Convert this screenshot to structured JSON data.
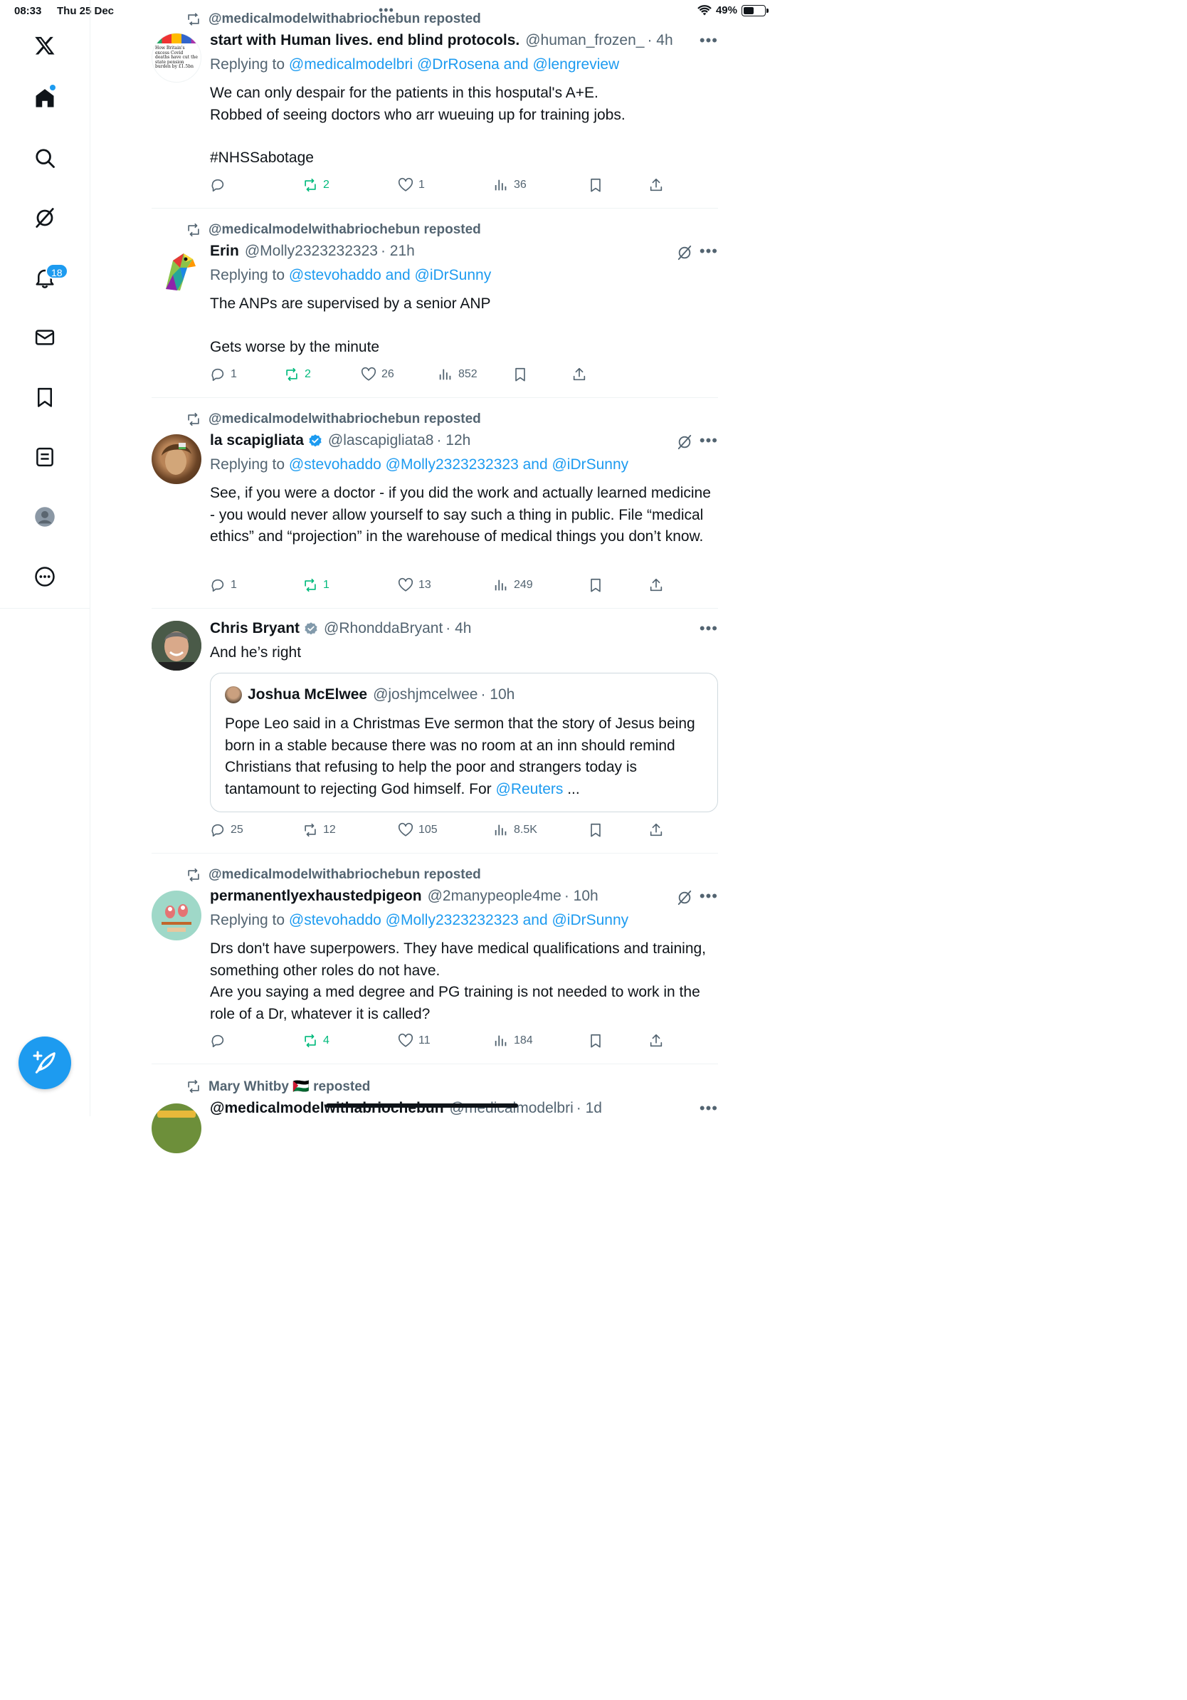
{
  "status_bar": {
    "time": "08:33",
    "date": "Thu 25 Dec",
    "battery": "49%"
  },
  "sidebar": {
    "notifications_badge": "18",
    "items": [
      "logo",
      "home",
      "search",
      "grok",
      "notifications",
      "messages",
      "bookmarks",
      "lists",
      "profile",
      "more"
    ]
  },
  "posts": [
    {
      "reposted_by": "@medicalmodelwithabriochebun reposted",
      "name": "start with Human lives. end blind protocols.",
      "handle": "@human_frozen_",
      "time": "· 4h",
      "replying_prefix": "Replying to",
      "replying_to": "@medicalmodelbri @DrRosena and @lengreview",
      "text": "We can only despair for the patients in this hosputal's A+E.\nRobbed of seeing doctors who arr wueuing up for training jobs.",
      "hashtag": "#NHSSabotage",
      "avatar_text": "How Britain's excess Covid deaths have cut the state pension burden by £1.5bn",
      "stats": {
        "replies": "",
        "reposts": "2",
        "likes": "1",
        "views": "36"
      }
    },
    {
      "reposted_by": "@medicalmodelwithabriochebun reposted",
      "name": "Erin",
      "handle": "@Molly2323232323",
      "time": "· 21h",
      "replying_prefix": "Replying to",
      "replying_to": "@stevohaddo and @iDrSunny",
      "text": "The ANPs are supervised by a senior ANP\n\nGets worse by the minute",
      "stats": {
        "replies": "1",
        "reposts": "2",
        "likes": "26",
        "views": "852"
      }
    },
    {
      "reposted_by": "@medicalmodelwithabriochebun reposted",
      "name": "la scapigliata",
      "handle": "@lascapigliata8",
      "time": "· 12h",
      "replying_prefix": "Replying to",
      "replying_to": "@stevohaddo @Molly2323232323 and @iDrSunny",
      "text": "See, if you were a doctor - if you did the work and actually learned medicine - you would never allow yourself to say such a thing in public. File “medical ethics” and “projection” in the warehouse of medical things you don’t know.",
      "stats": {
        "replies": "1",
        "reposts": "1",
        "likes": "13",
        "views": "249"
      }
    },
    {
      "name": "Chris Bryant",
      "handle": "@RhonddaBryant",
      "time": "· 4h",
      "text": "And he’s right",
      "quote": {
        "name": "Joshua McElwee",
        "handle": "@joshjmcelwee",
        "time": "· 10h",
        "text": "Pope Leo said in a Christmas Eve sermon that the story of Jesus being born in a stable because there was no room at an inn should remind Christians that refusing to help the poor and strangers today is tantamount to rejecting God himself. For ",
        "link": "@Reuters",
        "ellipsis": " ..."
      },
      "stats": {
        "replies": "25",
        "reposts": "12",
        "likes": "105",
        "views": "8.5K"
      }
    },
    {
      "reposted_by": "@medicalmodelwithabriochebun reposted",
      "name": "permanentlyexhaustedpigeon",
      "handle": "@2manypeople4me",
      "time": "· 10h",
      "replying_prefix": "Replying to",
      "replying_to": "@stevohaddo @Molly2323232323 and @iDrSunny",
      "text": "Drs don't have superpowers. They have medical qualifications and training, something other roles do not have.\nAre you saying a med degree and PG training is not needed to work in the role of a Dr, whatever it is called?",
      "stats": {
        "replies": "",
        "reposts": "4",
        "likes": "11",
        "views": "184"
      }
    },
    {
      "reposted_by": "Mary Whitby 🇵🇸 reposted",
      "name": "@medicalmodelwithabriochebun",
      "handle": "@medicalmodelbri",
      "time": "· 1d"
    }
  ],
  "colors": {
    "accent": "#1d9bf0",
    "repost_green": "#00ba7c",
    "secondary_text": "#536471",
    "divider": "#eff3f4"
  }
}
